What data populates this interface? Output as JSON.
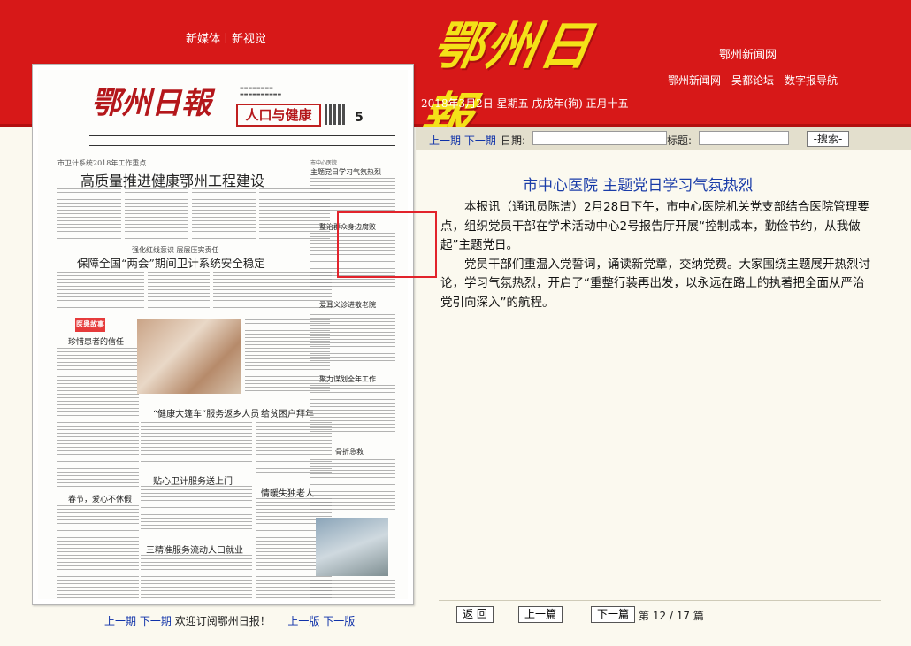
{
  "header": {
    "slogan": "新媒体丨新视觉",
    "logo": "鄂州日報",
    "site_name": "鄂州新闻网",
    "links": [
      "鄂州新闻网",
      "吴都论坛",
      "数字报导航"
    ],
    "date": "2018年3月2日 星期五 戊戌年(狗) 正月十五"
  },
  "paper": {
    "masthead": "鄂州日報",
    "section_badge": "人口与健康",
    "page_number": "5",
    "headlines": {
      "h1_kicker": "市卫计系统2018年工作重点",
      "h1": "高质量推进健康鄂州工程建设",
      "h2_kicker": "强化红线意识 层层压实责任",
      "h2": "保障全国“两会”期间卫计系统安全稳定",
      "side1_kicker": "市中心医院",
      "side1": "主题党日学习气氛热烈",
      "side2": "整治群众身边腐败",
      "side3": "爱耳义诊进敬老院",
      "side4": "聚力谋划全年工作",
      "col_a1": "珍惜患者的信任",
      "col_a2": "春节，爱心不休假",
      "mid1": "“健康大篷车”服务返乡人员",
      "mid2": "贴心卫计服务送上门",
      "mid3": "三精准服务流动人口就业",
      "mid4": "给贫困户拜年",
      "mid5": "情暖失独老人",
      "side5": "骨折急救",
      "tag": "医患故事"
    },
    "nav": {
      "prev_issue": "上一期",
      "next_issue": "下一期",
      "welcome": "欢迎订阅鄂州日报！",
      "prev_page": "上一版",
      "next_page": "下一版"
    }
  },
  "search": {
    "prev_issue": "上一期",
    "next_issue": "下一期",
    "date_label": "日期:",
    "title_label": "标题:",
    "date_value": "",
    "title_value": "",
    "button": "-搜索-"
  },
  "article": {
    "title": "市中心医院  主题党日学习气氛热烈",
    "paragraphs": [
      "本报讯（通讯员陈洁）2月28日下午，市中心医院机关党支部结合医院管理要点，组织党员干部在学术活动中心2号报告厅开展“控制成本，勤俭节约，从我做起”主题党日。",
      "党员干部们重温入党誓词，诵读新党章，交纳党费。大家围绕主题展开热烈讨论，学习气氛热烈，开启了“重整行装再出发，以永远在路上的执著把全面从严治党引向深入”的航程。"
    ]
  },
  "pager": {
    "back": "返 回",
    "prev": "上一篇",
    "next": "下一篇",
    "count": "第 12 / 17 篇"
  }
}
